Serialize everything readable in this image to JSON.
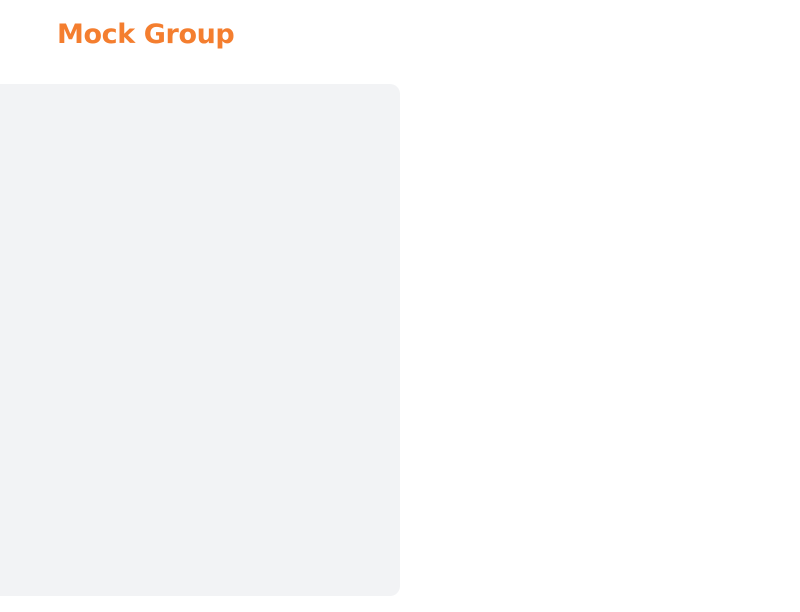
{
  "header": {
    "brand_name": "Mock Group"
  },
  "colors": {
    "brand": "#f47e2f",
    "panel_background": "#f2f3f5",
    "page_background": "#ffffff"
  }
}
